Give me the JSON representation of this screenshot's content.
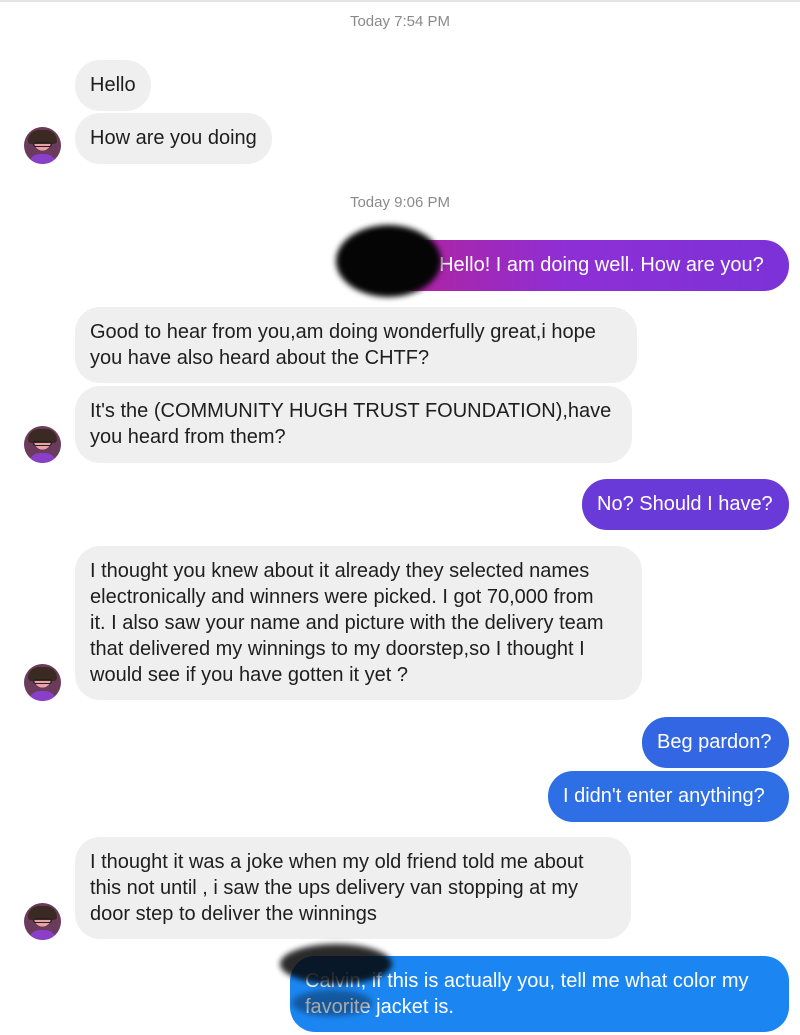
{
  "timestamps": [
    "Today 7:54 PM",
    "Today 9:06 PM"
  ],
  "messages": [
    {
      "from": "them",
      "text": "Hello"
    },
    {
      "from": "them",
      "text": "How are you doing"
    },
    {
      "from": "me",
      "text": "! Hello! I am doing well. How are you?"
    },
    {
      "from": "them",
      "lines": [
        "Good to hear from you,am doing wonderfully great,i hope",
        "you have also heard about the CHTF?"
      ]
    },
    {
      "from": "them",
      "lines": [
        "It's the (COMMUNITY HUGH TRUST FOUNDATION),have",
        "you heard from them?"
      ]
    },
    {
      "from": "me",
      "text": "No? Should I have?"
    },
    {
      "from": "them",
      "lines": [
        "I thought you knew about it already they selected names",
        "electronically and winners were picked. I got 70,000 from",
        "it. I also saw your name and picture with the delivery team",
        "that delivered my winnings to my doorstep,so I thought I",
        "would see if you have gotten it yet ?"
      ]
    },
    {
      "from": "me",
      "text": "Beg pardon?"
    },
    {
      "from": "me",
      "text": "I didn't enter anything?"
    },
    {
      "from": "them",
      "lines": [
        "I thought it was a joke when my old friend told me about",
        "this not until , i saw the ups delivery van stopping at my",
        "door step to deliver the winnings"
      ]
    },
    {
      "from": "me",
      "lines": [
        "Calvin, if this is actually you, tell me what color my",
        "favorite jacket is."
      ]
    }
  ],
  "colors": {
    "incoming": "#efefef",
    "outgoing_gradient": [
      "#c3208b",
      "#8a2be2",
      "#5b3ae0",
      "#2f6be3",
      "#1a86f0"
    ]
  }
}
